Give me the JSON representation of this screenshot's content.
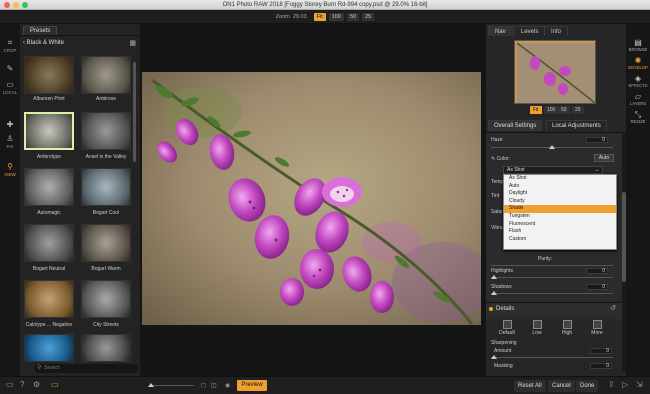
{
  "window": {
    "title": "ON1 Photo RAW 2018 [Foggy Storey Burn Rd-994 copy.psd @ 29.0% 16-bit]"
  },
  "zoom": {
    "label": "Zoom",
    "value": "29.03",
    "buttons": [
      "Fit",
      "100",
      "50",
      "25"
    ]
  },
  "left_tools": [
    "CROP",
    "LOCAL",
    "FIX",
    "VIEW"
  ],
  "presets": {
    "tab": "Presets",
    "category": "Black & White",
    "items": [
      "Albumen Print",
      "Ambrose",
      "Ambrotype",
      "Ansel in the Valley",
      "Automagic",
      "Bogart Cool",
      "Bogart Neutral",
      "Bogart Warm",
      "Calotype ... Negative",
      "City Streets",
      "",
      ""
    ],
    "search_placeholder": "Search"
  },
  "right_panel": {
    "tabs": [
      "Nav",
      "Levels",
      "Info"
    ],
    "nav_zoom": [
      "Fit",
      "100",
      "50",
      "25"
    ],
    "adj_tabs": [
      "Overall Settings",
      "Local Adjustments"
    ],
    "haze": {
      "label": "Haze",
      "value": "0"
    },
    "color": {
      "label": "Color:",
      "auto": "Auto"
    },
    "partial_labels": [
      "Temp",
      "Tint",
      "Satur",
      "Vibra"
    ],
    "wb_selected": "As Shot",
    "wb_options": [
      "As Shot",
      "Auto",
      "Daylight",
      "Cloudy",
      "Shade",
      "Tungsten",
      "Fluorescent",
      "Flash",
      "Custom"
    ],
    "wb_highlighted": "Shade",
    "purity": "Purity:",
    "highlights": {
      "label": "Highlights",
      "value": "0"
    },
    "shadows": {
      "label": "Shadows",
      "value": "0"
    },
    "details": {
      "title": "Details",
      "modes": [
        "Default",
        "Low",
        "High",
        "More"
      ],
      "sharpening": "Sharpening",
      "amount": {
        "label": "Amount",
        "value": "0"
      },
      "masking": {
        "label": "Masking",
        "value": "0"
      }
    }
  },
  "modules": [
    "BROWSE",
    "DEVELOP",
    "EFFECTS",
    "LAYERS",
    "RESIZE"
  ],
  "bottom": {
    "preview": "Preview",
    "reset": "Reset All",
    "cancel": "Cancel",
    "done": "Done"
  }
}
